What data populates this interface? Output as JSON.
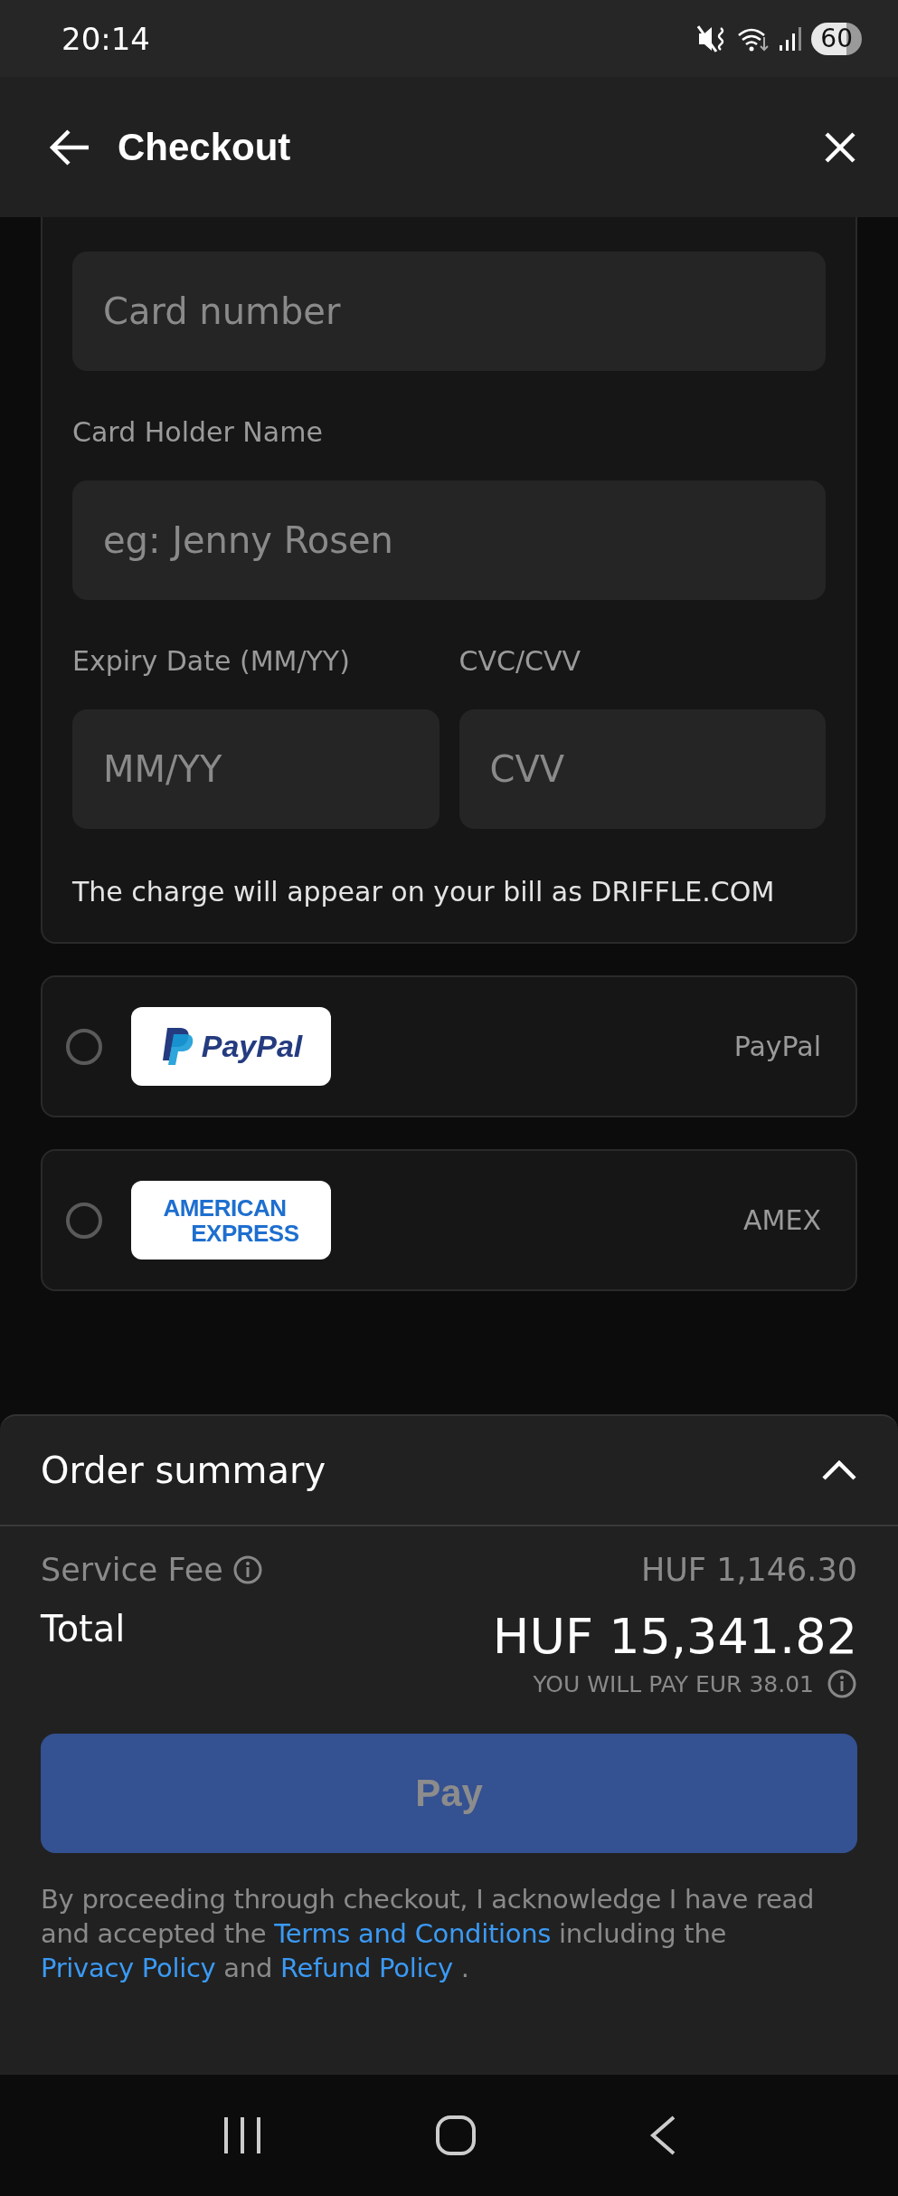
{
  "status_bar": {
    "time": "20:14",
    "battery": "60"
  },
  "header": {
    "title": "Checkout"
  },
  "card_form": {
    "fields": [
      {
        "placeholder": "Card number",
        "kind": "full"
      },
      {
        "label": "Card Holder Name",
        "placeholder": "eg: Jenny Rosen",
        "kind": "full"
      },
      {
        "label": "Expiry Date (MM/YY)",
        "placeholder": "MM/YY",
        "kind": "half"
      },
      {
        "label": "CVC/CVV",
        "placeholder": "CVV",
        "kind": "half"
      }
    ],
    "note": "The charge will appear on your bill as DRIFFLE.COM"
  },
  "payment_options": [
    {
      "kind": "paypal",
      "logo_lines": [
        "PayPal"
      ],
      "name": "PayPal",
      "selected": false
    },
    {
      "kind": "amex",
      "logo_lines": [
        "AMERICAN",
        "EXPRESS"
      ],
      "name": "AMEX",
      "selected": false
    }
  ],
  "order_summary": {
    "title": "Order summary",
    "expanded": true,
    "service_fee": {
      "label": "Service Fee",
      "value": "HUF 1,146.30"
    },
    "total": {
      "label": "Total",
      "value": "HUF 15,341.82",
      "conversion": "YOU WILL PAY EUR 38.01"
    },
    "pay_button": {
      "label": "Pay",
      "disabled": true
    },
    "legal": [
      {
        "text": "By proceeding through checkout, I acknowledge I have read and accepted the ",
        "link": false
      },
      {
        "text": "Terms and Conditions",
        "link": true
      },
      {
        "text": " including the ",
        "link": false
      },
      {
        "text": "Privacy Policy",
        "link": true
      },
      {
        "text": " and ",
        "link": false
      },
      {
        "text": "Refund Policy",
        "link": true
      },
      {
        "text": " .",
        "link": false
      }
    ]
  }
}
